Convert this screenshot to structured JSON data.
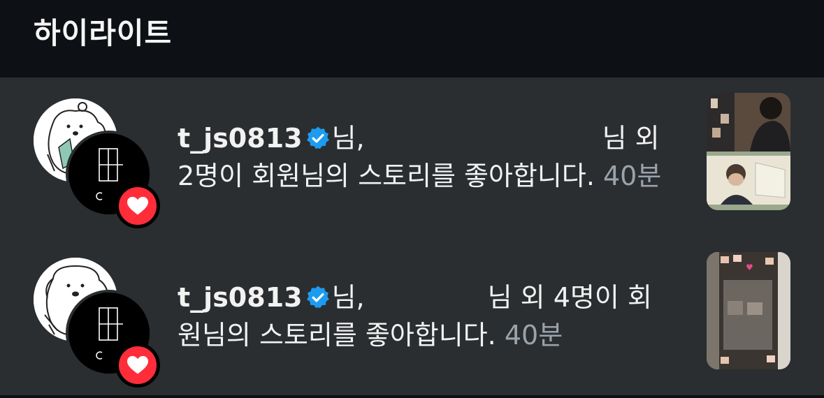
{
  "header": {
    "title": "하이라이트"
  },
  "notifications": [
    {
      "username": "t_js0813",
      "line1_suffix": "님,",
      "line1_end": "님 외",
      "line2_text": "2명이 회원님의 스토리를 좋아합니다.",
      "time": "40분"
    },
    {
      "username": "t_js0813",
      "line1_suffix": "님,",
      "line1_end": "님 외 4명이 회",
      "line2_text": "원님의 스토리를 좋아합니다.",
      "time": "40분"
    }
  ],
  "colors": {
    "background": "#2a2e31",
    "header_bg": "#0d1014",
    "heart_badge": "#ff2d3a",
    "verified": "#1d9bf0",
    "time_text": "#9aa3ab"
  },
  "icons": {
    "verified": "verified-badge-icon",
    "heart": "heart-icon"
  }
}
